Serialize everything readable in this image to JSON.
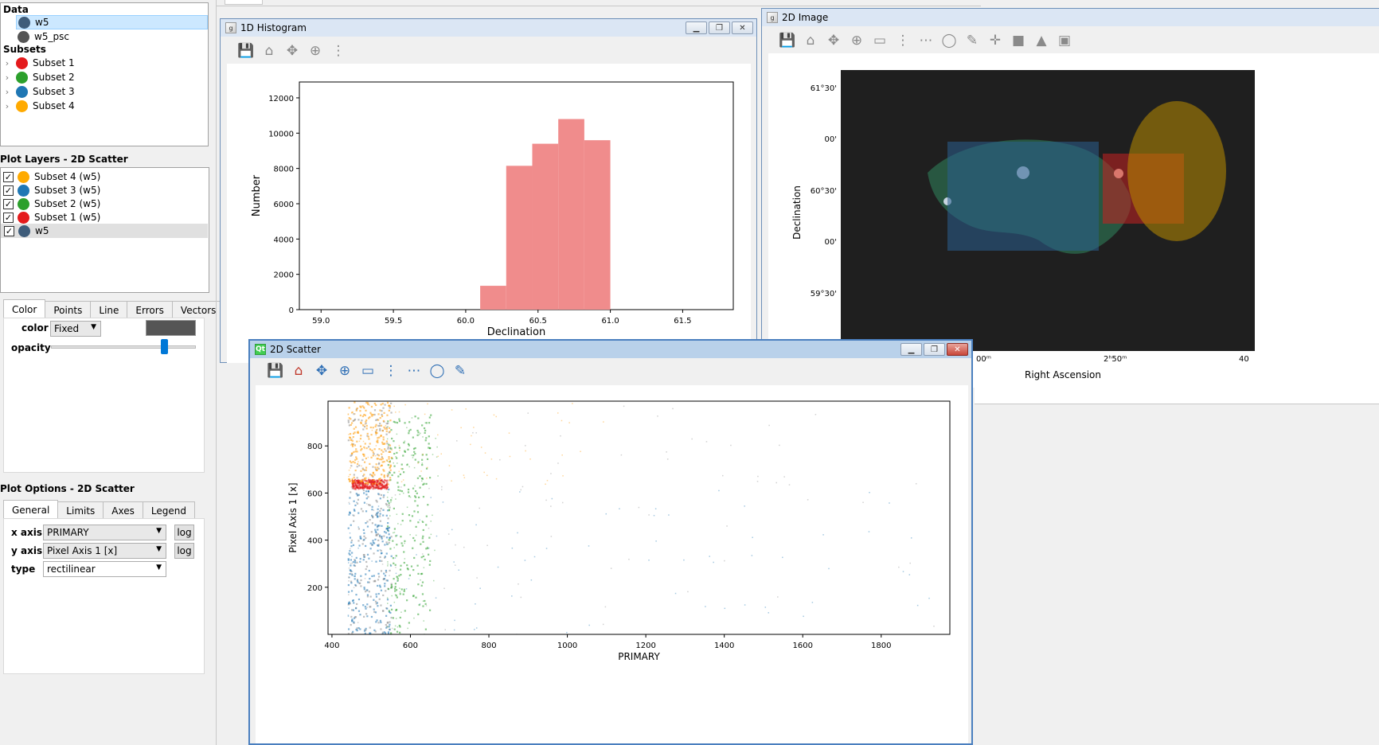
{
  "data_panel": {
    "title": "Data",
    "items": [
      {
        "label": "w5",
        "color": "#3e5c7a"
      },
      {
        "label": "w5_psc",
        "color": "#555555"
      }
    ],
    "subsets_title": "Subsets",
    "subsets": [
      {
        "label": "Subset 1",
        "color": "#e41a1c"
      },
      {
        "label": "Subset 2",
        "color": "#2ca02c"
      },
      {
        "label": "Subset 3",
        "color": "#1f77b4"
      },
      {
        "label": "Subset 4",
        "color": "#ffaa00"
      }
    ]
  },
  "plot_layers": {
    "title": "Plot Layers - 2D Scatter",
    "items": [
      {
        "label": "Subset 4 (w5)",
        "color": "#ffaa00",
        "checked": true
      },
      {
        "label": "Subset 3 (w5)",
        "color": "#1f77b4",
        "checked": true
      },
      {
        "label": "Subset 2 (w5)",
        "color": "#2ca02c",
        "checked": true
      },
      {
        "label": "Subset 1 (w5)",
        "color": "#e41a1c",
        "checked": true
      },
      {
        "label": "w5",
        "color": "#3e5c7a",
        "checked": true
      }
    ]
  },
  "layer_style": {
    "tabs": [
      "Color",
      "Points",
      "Line",
      "Errors",
      "Vectors"
    ],
    "color_label": "color",
    "color_mode": "Fixed",
    "swatch_color": "#555555",
    "opacity_label": "opacity",
    "opacity_value": 0.78
  },
  "plot_options": {
    "title": "Plot Options - 2D Scatter",
    "tabs": [
      "General",
      "Limits",
      "Axes",
      "Legend"
    ],
    "x_axis_label": "x axis",
    "x_axis_value": "PRIMARY",
    "y_axis_label": "y axis",
    "y_axis_value": "Pixel Axis 1 [x]",
    "type_label": "type",
    "type_value": "rectilinear",
    "log_label": "log"
  },
  "histogram_window": {
    "title": "1D Histogram",
    "chart_data": {
      "type": "bar",
      "xlabel": "Declination",
      "ylabel": "Number",
      "xlim": [
        58.85,
        61.85
      ],
      "ylim": [
        0,
        12900
      ],
      "xticks": [
        59.0,
        59.5,
        60.0,
        60.5,
        61.0,
        61.5
      ],
      "xtick_labels": [
        "59.0",
        "59.5",
        "60.0",
        "60.5",
        "61.0",
        "61.5"
      ],
      "yticks": [
        0,
        2000,
        4000,
        6000,
        8000,
        10000,
        12000
      ],
      "ytick_labels": [
        "0",
        "2000",
        "4000",
        "6000",
        "8000",
        "10000",
        "12000"
      ],
      "bins": [
        {
          "x0": 60.1,
          "x1": 60.28,
          "value": 1350
        },
        {
          "x0": 60.28,
          "x1": 60.46,
          "value": 8150
        },
        {
          "x0": 60.46,
          "x1": 60.64,
          "value": 9400
        },
        {
          "x0": 60.64,
          "x1": 60.82,
          "value": 10800
        },
        {
          "x0": 60.82,
          "x1": 61.0,
          "value": 9600
        }
      ],
      "color": "#f08c8c"
    }
  },
  "image_window": {
    "title": "2D Image",
    "ylabel": "Declination",
    "xlabel": "Right Ascension",
    "yticks": [
      "61°30'",
      "00'",
      "60°30'",
      "00'",
      "59°30'"
    ],
    "xticks": [
      "00ᵐ",
      "2ʰ50ᵐ",
      "40"
    ]
  },
  "scatter_window": {
    "title": "2D Scatter",
    "chart_data": {
      "type": "scatter",
      "xlabel": "PRIMARY",
      "ylabel": "Pixel Axis 1 [x]",
      "xlim": [
        390,
        1975
      ],
      "ylim": [
        0,
        990
      ],
      "xticks": [
        400,
        600,
        800,
        1000,
        1200,
        1400,
        1600,
        1800
      ],
      "xtick_labels": [
        "400",
        "600",
        "800",
        "1000",
        "1200",
        "1400",
        "1600",
        "1800"
      ],
      "yticks": [
        200,
        400,
        600,
        800
      ],
      "ytick_labels": [
        "200",
        "400",
        "600",
        "800"
      ],
      "series": [
        {
          "layer": "w5",
          "color": "#8c8c8c",
          "x_range": [
            440,
            1950
          ],
          "y_range": [
            0,
            990
          ]
        },
        {
          "layer": "Subset 3",
          "color": "#1f77b4",
          "x_range": [
            440,
            1950
          ],
          "y_range": [
            0,
            620
          ]
        },
        {
          "layer": "Subset 2",
          "color": "#2ca02c",
          "x_range": [
            540,
            670
          ],
          "y_range": [
            0,
            940
          ]
        },
        {
          "layer": "Subset 1",
          "color": "#e41a1c",
          "x_range": [
            450,
            540
          ],
          "y_range": [
            620,
            660
          ]
        },
        {
          "layer": "Subset 4",
          "color": "#ff9900",
          "x_range": [
            440,
            1100
          ],
          "y_range": [
            640,
            990
          ]
        }
      ]
    }
  }
}
